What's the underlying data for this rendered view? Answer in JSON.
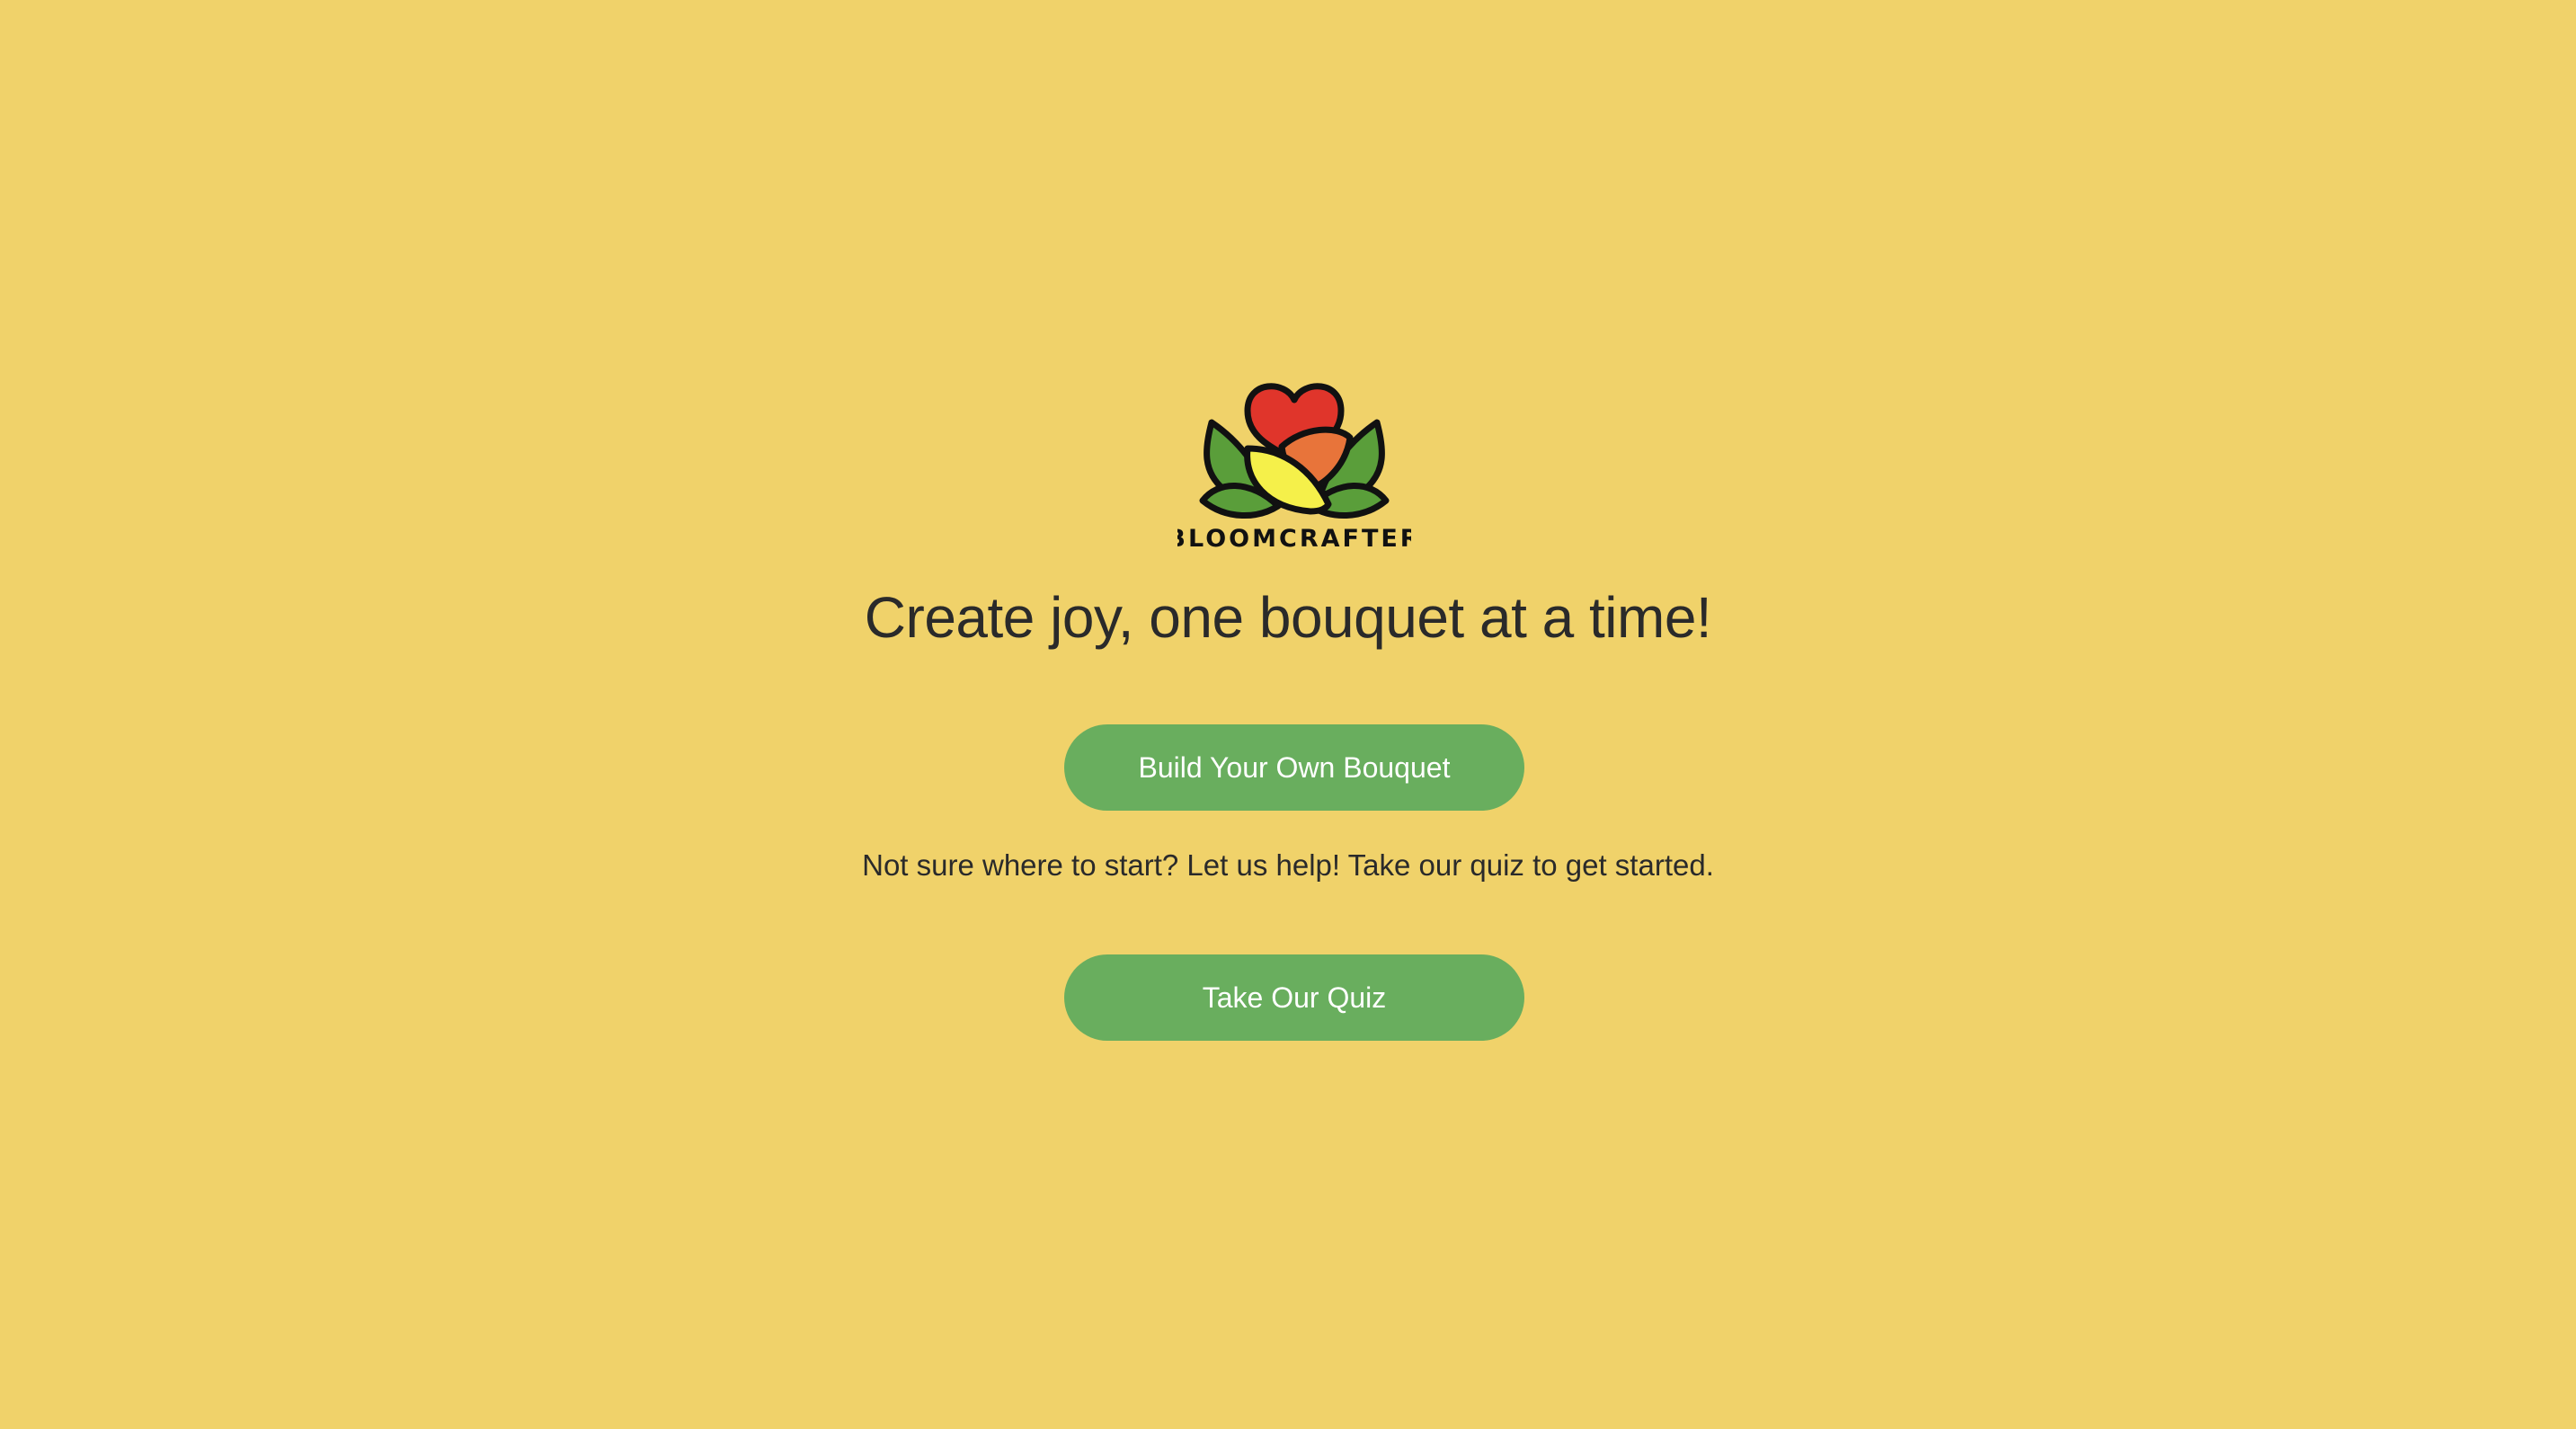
{
  "brand": {
    "name": "BLOOMCRAFTER",
    "logo_icon": "flower-logo-icon",
    "colors": {
      "background": "#F0D26A",
      "button": "#69AE5E",
      "petal_red": "#E0352B",
      "petal_orange": "#E8743A",
      "petal_yellow": "#F5F04A",
      "leaf_green": "#5A9E3A"
    }
  },
  "hero": {
    "headline": "Create joy, one bouquet at a time!"
  },
  "actions": {
    "build_label": "Build Your Own Bouquet",
    "helper_text": "Not sure where to start? Let us help! Take our quiz to get started.",
    "quiz_label": "Take Our Quiz"
  }
}
